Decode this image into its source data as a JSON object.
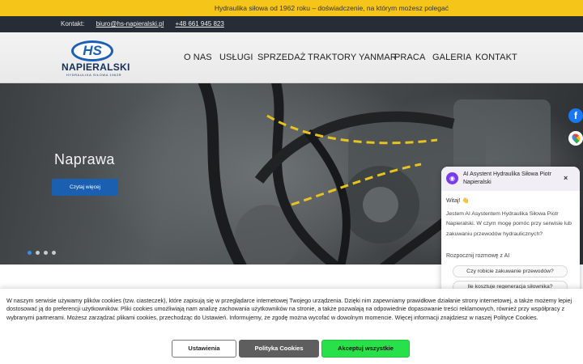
{
  "topbar": {
    "text": "Hydraulika siłowa od 1962 roku – doświadczenie, na którym możesz polegać"
  },
  "contact": {
    "label": "Kontakt:",
    "email": "biuro@hs-napieralski.pl",
    "phone": "+48 661 945 823"
  },
  "logo": {
    "mark": "HS",
    "name": "NAPIERALSKI",
    "tagline": "HYDRAULIKA SIŁOWA 1962R"
  },
  "nav": {
    "items": [
      "O NAS",
      "USŁUGI",
      "SPRZEDAŻ",
      "TRAKTORY YANMAR",
      "PRACA",
      "GALERIA",
      "KONTAKT"
    ]
  },
  "hero": {
    "title": "Naprawa",
    "button": "Czytaj więcej",
    "slides": 4,
    "active_slide": 1
  },
  "social": {
    "facebook": "f"
  },
  "chat": {
    "title": "AI Asystent Hydraulika Siłowa Piotr Napieralski",
    "greeting": "Witaj! 👋",
    "message": "Jestem AI Asystentem Hydraulika Siłowa Piotr Napieralski. W czym mogę pomóc przy serwisie lub zakuwaniu przewodów hydraulicznych?",
    "start_label": "Rozpocznij rozmowę z AI",
    "suggestions": [
      "Czy robicie zakuwanie przewodów?",
      "Ile kosztuje regeneracja siłownika?"
    ],
    "close": "×"
  },
  "cookie": {
    "text": "W naszym serwisie używamy plików cookies (tzw. ciasteczek), które zapisują się w przeglądarce internetowej Twojego urządzenia. Dzięki nim zapewniamy prawidłowe działanie strony internetowej, a także możemy lepiej dostosować ją do preferencji użytkowników. Pliki cookies umożliwiają nam analizę zachowania użytkowników na stronie, a także pozwalają na odpowiednie dopasowanie treści reklamowych, również przy współpracy z wybranymi partnerami. Możesz zarządzać plikami cookies, przechodząc do Ustawień. Informujemy, że zgodę można wycofać w dowolnym momencie. Więcej informacji znajdziesz w naszej Polityce Cookies.",
    "settings": "Ustawienia",
    "policy": "Polityka Cookies",
    "accept": "Akceptuj wszystkie"
  },
  "colors": {
    "topbar": "#f5c51a",
    "contactbar": "#262d36",
    "brand_blue": "#1b5fb8",
    "accept_green": "#28e04a"
  }
}
